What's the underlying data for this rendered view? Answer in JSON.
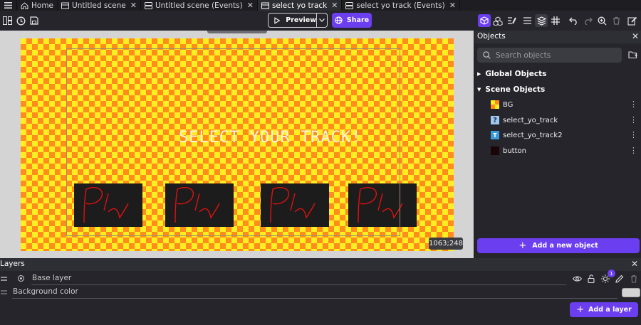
{
  "tabs": [
    {
      "label": "Home",
      "icon": "home-icon"
    },
    {
      "label": "Untitled scene",
      "icon": "scene-icon"
    },
    {
      "label": "Untitled scene (Events)",
      "icon": "events-icon"
    },
    {
      "label": "select yo track",
      "icon": "scene-icon",
      "active": true
    },
    {
      "label": "select yo track (Events)",
      "icon": "events-icon"
    }
  ],
  "toolbar": {
    "preview_label": "Preview",
    "share_label": "Share"
  },
  "scene": {
    "title_text": "SELECT YOUR TRACK!",
    "coordinates": "1063;248",
    "colors": {
      "check_a": "#ffee22",
      "check_b": "#ff8d1c",
      "button_bg": "#1c1c1c",
      "scribble": "#e01010"
    }
  },
  "objects_panel": {
    "title": "Objects",
    "search_placeholder": "Search objects",
    "global_group": "Global Objects",
    "scene_group": "Scene Objects",
    "items": [
      {
        "name": "BG",
        "thumb": "checker-thumb"
      },
      {
        "name": "select_yo_track",
        "thumb": "question-thumb"
      },
      {
        "name": "select_yo_track2",
        "thumb": "text-thumb"
      },
      {
        "name": "button",
        "thumb": "dark-thumb"
      }
    ],
    "add_object_label": "Add a new object"
  },
  "layers_panel": {
    "title": "Layers",
    "base_layer": "Base layer",
    "background_color_label": "Background color",
    "badge_count": "1",
    "add_layer_label": "Add a layer",
    "background_swatch": "#d4d4d4"
  },
  "accent_color": "#6b3ef0"
}
